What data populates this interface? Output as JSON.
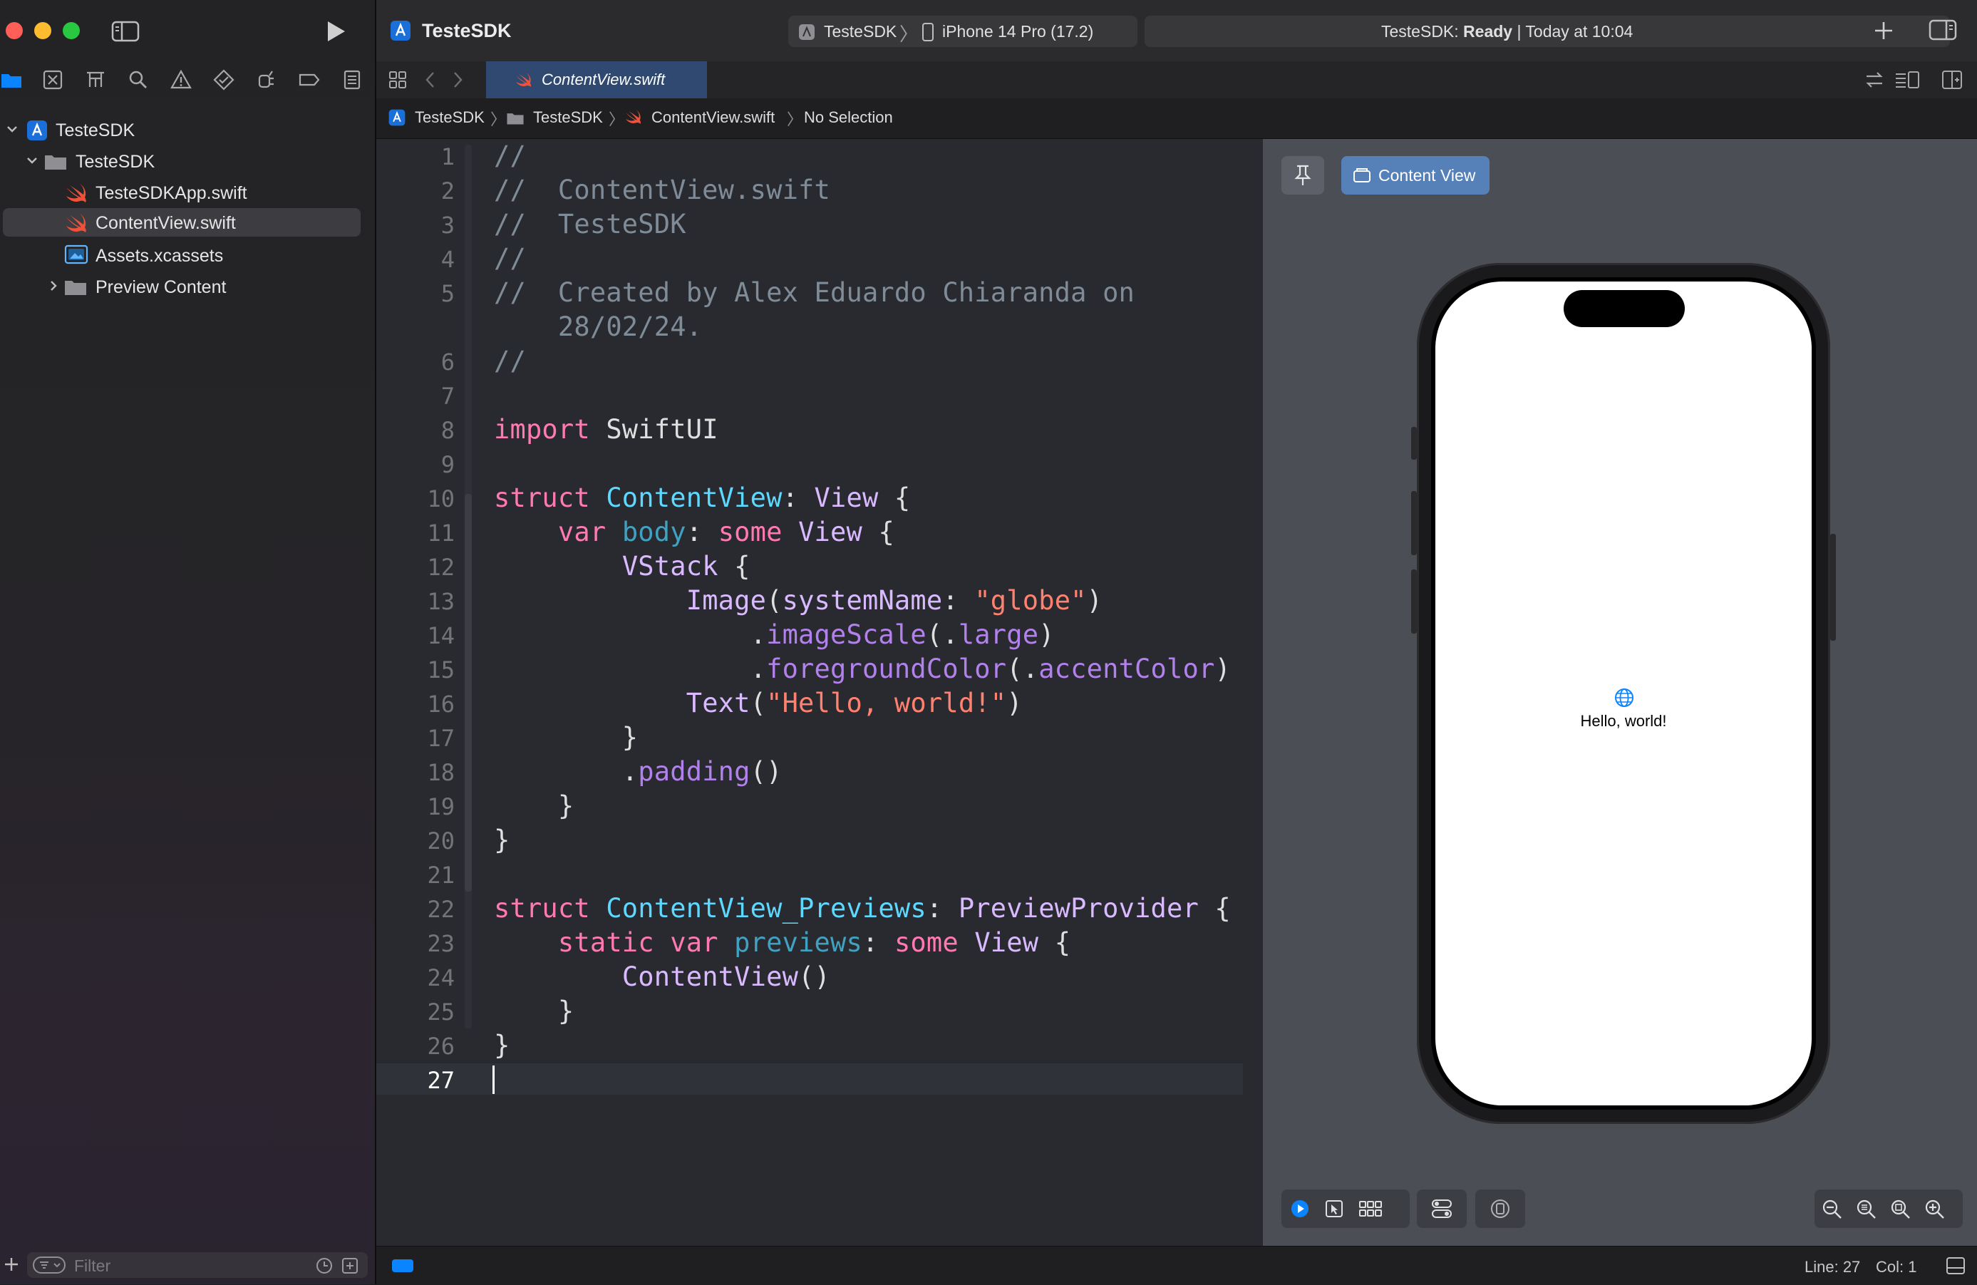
{
  "window": {
    "traffic_colors": [
      "#ff5f57",
      "#febc2e",
      "#28c840"
    ]
  },
  "toolbar": {
    "project_name": "TesteSDK",
    "scheme": "TesteSDK",
    "destination": "iPhone 14 Pro (17.2)",
    "status_project": "TesteSDK:",
    "status_state": "Ready",
    "status_time": "| Today at 10:04"
  },
  "sidebar": {
    "tree": [
      {
        "label": "TesteSDK",
        "type": "project",
        "expanded": true
      },
      {
        "label": "TesteSDK",
        "type": "folder",
        "expanded": true
      },
      {
        "label": "TesteSDKApp.swift",
        "type": "swift-file"
      },
      {
        "label": "ContentView.swift",
        "type": "swift-file",
        "selected": true
      },
      {
        "label": "Assets.xcassets",
        "type": "asset-catalog"
      },
      {
        "label": "Preview Content",
        "type": "folder",
        "expanded": false
      }
    ],
    "filter_placeholder": "Filter"
  },
  "tabs": {
    "active_tab": "ContentView.swift"
  },
  "breadcrumb": {
    "items": [
      "TesteSDK",
      "TesteSDK",
      "ContentView.swift",
      "No Selection"
    ]
  },
  "editor": {
    "line_numbers": [
      "1",
      "2",
      "3",
      "4",
      "5",
      "6",
      "7",
      "8",
      "9",
      "10",
      "11",
      "12",
      "13",
      "14",
      "15",
      "16",
      "17",
      "18",
      "19",
      "20",
      "21",
      "22",
      "23",
      "24",
      "25",
      "26",
      "27"
    ],
    "current_line": "27",
    "code": {
      "l1": "//",
      "l2": "//  ContentView.swift",
      "l3": "//  TesteSDK",
      "l4": "//",
      "l5a": "//  Created by Alex Eduardo Chiaranda on",
      "l5b": "    28/02/24.",
      "l6": "//",
      "l8_kw": "import",
      "l8_rest": " SwiftUI",
      "l10_kw": "struct",
      "l10_name": " ContentView",
      "l10_colon": ": ",
      "l10_type": "View",
      "l10_brace": " {",
      "l11_indent": "    ",
      "l11_kw": "var",
      "l11_name": " body",
      "l11_colon": ": ",
      "l11_kw2": "some",
      "l11_type": " View",
      "l11_brace": " {",
      "l12_indent": "        ",
      "l12_type": "VStack",
      "l12_brace": " {",
      "l13_indent": "            ",
      "l13_type": "Image",
      "l13_open": "(",
      "l13_arg": "systemName",
      "l13_colon": ": ",
      "l13_str": "\"globe\"",
      "l13_close": ")",
      "l14_indent": "                .",
      "l14_meth": "imageScale",
      "l14_open": "(.",
      "l14_val": "large",
      "l14_close": ")",
      "l15_indent": "                .",
      "l15_meth": "foregroundColor",
      "l15_open": "(.",
      "l15_val": "accentColor",
      "l15_close": ")",
      "l16_indent": "            ",
      "l16_type": "Text",
      "l16_open": "(",
      "l16_str": "\"Hello, world!\"",
      "l16_close": ")",
      "l17": "        }",
      "l18_indent": "        .",
      "l18_meth": "padding",
      "l18_close": "()",
      "l19": "    }",
      "l20": "}",
      "l22_kw": "struct",
      "l22_name": " ContentView_Previews",
      "l22_colon": ": ",
      "l22_type": "PreviewProvider",
      "l22_brace": " {",
      "l23_indent": "    ",
      "l23_kw": "static",
      "l23_sp": " ",
      "l23_kw2": "var",
      "l23_name": " previews",
      "l23_colon": ": ",
      "l23_kw3": "some",
      "l23_type": " View",
      "l23_brace": " {",
      "l24_indent": "        ",
      "l24_type": "ContentView",
      "l24_close": "()",
      "l25": "    }",
      "l26": "}"
    }
  },
  "canvas": {
    "preview_label": "Content View",
    "device_text": "Hello, world!"
  },
  "status": {
    "line": "Line: 27",
    "col": "Col: 1"
  },
  "colors": {
    "accent": "#0a84ff",
    "editor_bg": "#292a30",
    "canvas_bg": "#4b4e55",
    "swift_orange": "#f05138"
  }
}
